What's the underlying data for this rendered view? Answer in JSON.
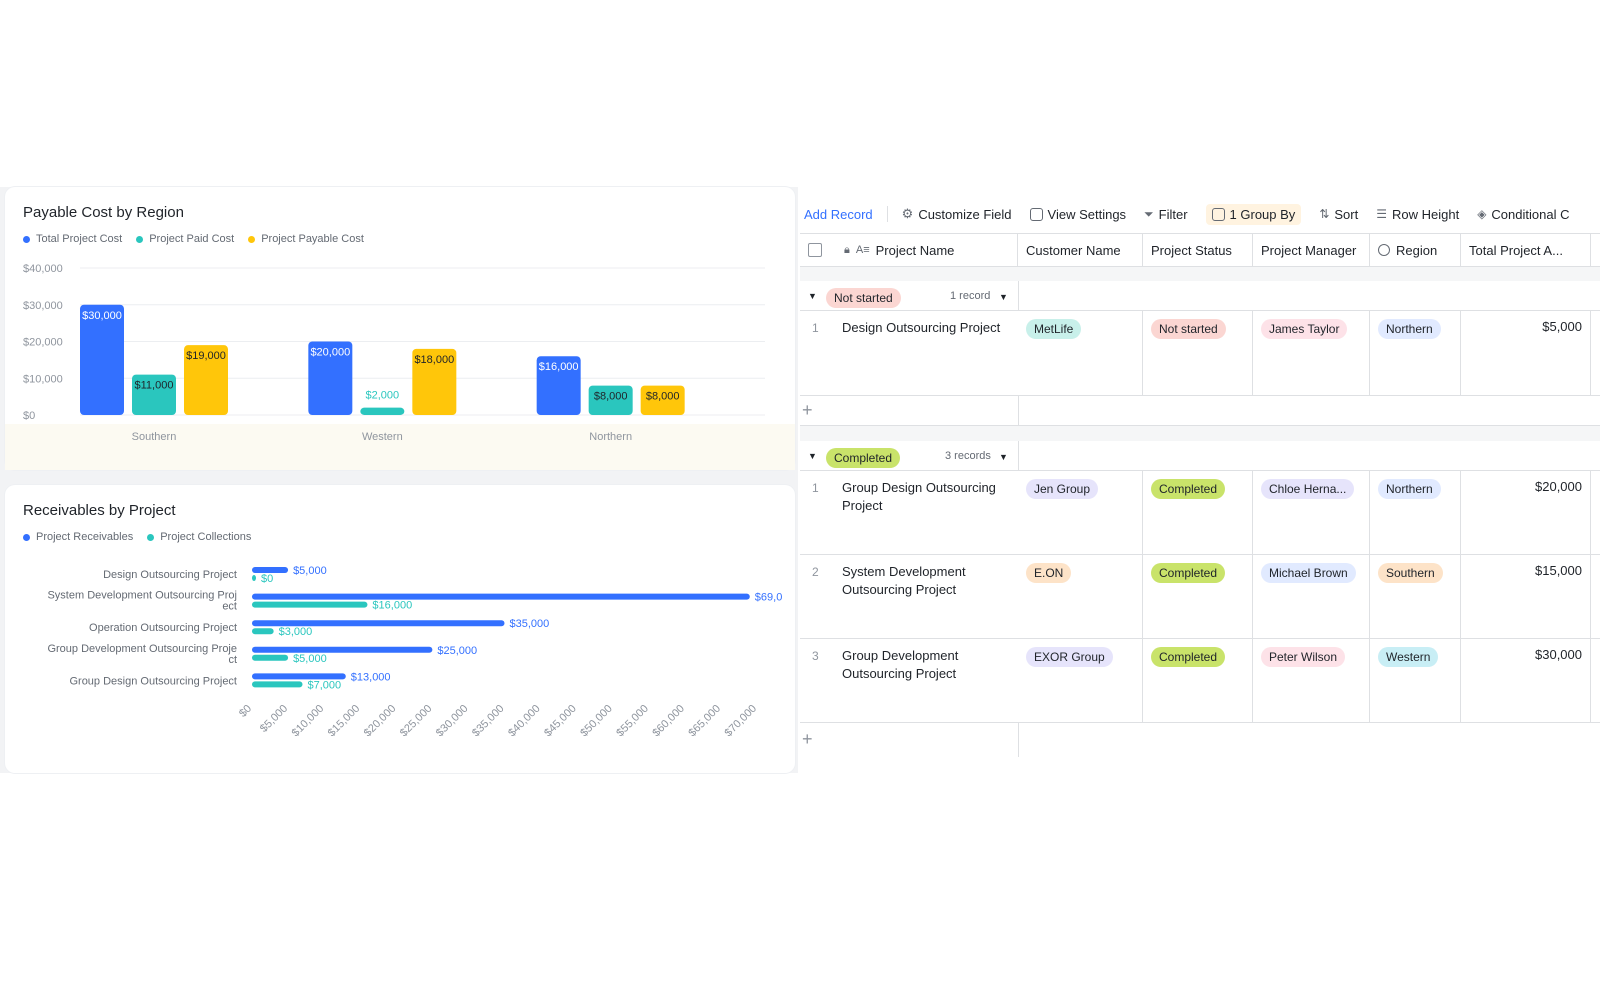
{
  "payable_card": {
    "title": "Payable Cost by Region",
    "legend": [
      {
        "label": "Total Project Cost",
        "color": "#3370ff"
      },
      {
        "label": "Project Paid Cost",
        "color": "#2ac6be"
      },
      {
        "label": "Project Payable Cost",
        "color": "#ffc60a"
      }
    ]
  },
  "receivables_card": {
    "title": "Receivables by Project",
    "legend": [
      {
        "label": "Project Receivables",
        "color": "#3370ff"
      },
      {
        "label": "Project Collections",
        "color": "#2ac6be"
      }
    ]
  },
  "chart_data": [
    {
      "type": "bar",
      "title": "Payable Cost by Region",
      "categories": [
        "Southern",
        "Western",
        "Northern"
      ],
      "y_ticks": [
        "$0",
        "$10,000",
        "$20,000",
        "$30,000",
        "$40,000"
      ],
      "ylim": [
        0,
        40000
      ],
      "legend_position": "top-left",
      "series": [
        {
          "name": "Total Project Cost",
          "color": "#3370ff",
          "values": [
            30000,
            20000,
            16000
          ],
          "labels": [
            "$30,000",
            "$20,000",
            "$16,000"
          ]
        },
        {
          "name": "Project Paid Cost",
          "color": "#2ac6be",
          "values": [
            11000,
            2000,
            8000
          ],
          "labels": [
            "$11,000",
            "$2,000",
            "$8,000"
          ]
        },
        {
          "name": "Project Payable Cost",
          "color": "#ffc60a",
          "values": [
            19000,
            18000,
            8000
          ],
          "labels": [
            "$19,000",
            "$18,000",
            "$8,000"
          ]
        }
      ]
    },
    {
      "type": "bar",
      "orientation": "horizontal",
      "title": "Receivables by Project",
      "categories": [
        "Design Outsourcing Project",
        "System Development Outsourcing Project",
        "Operation Outsourcing Project",
        "Group Development Outsourcing Project",
        "Group Design Outsourcing Project"
      ],
      "category_lines": [
        [
          "Design Outsourcing Project"
        ],
        [
          "System Development Outsourcing Proj",
          "ect"
        ],
        [
          "Operation Outsourcing Project"
        ],
        [
          "Group Development Outsourcing Proje",
          "ct"
        ],
        [
          "Group Design Outsourcing Project"
        ]
      ],
      "x_ticks": [
        "$0",
        "$5,000",
        "$10,000",
        "$15,000",
        "$20,000",
        "$25,000",
        "$30,000",
        "$35,000",
        "$40,000",
        "$45,000",
        "$50,000",
        "$55,000",
        "$60,000",
        "$65,000",
        "$70,000"
      ],
      "xlim": [
        0,
        70000
      ],
      "legend_position": "top-left",
      "series": [
        {
          "name": "Project Receivables",
          "color": "#3370ff",
          "values": [
            5000,
            69000,
            35000,
            25000,
            13000
          ],
          "labels": [
            "$5,000",
            "$69,0",
            "$35,000",
            "$25,000",
            "$13,000"
          ]
        },
        {
          "name": "Project Collections",
          "color": "#2ac6be",
          "values": [
            0,
            16000,
            3000,
            5000,
            7000
          ],
          "labels": [
            "$0",
            "$16,000",
            "$3,000",
            "$5,000",
            "$7,000"
          ]
        }
      ]
    }
  ],
  "toolbar": {
    "add_record": "Add Record",
    "customize_field": "Customize Field",
    "view_settings": "View Settings",
    "filter": "Filter",
    "group_by": "1 Group By",
    "sort": "Sort",
    "row_height": "Row Height",
    "conditional": "Conditional C"
  },
  "columns": {
    "project_name": "Project Name",
    "customer_name": "Customer Name",
    "project_status": "Project Status",
    "project_manager": "Project Manager",
    "region": "Region",
    "total_project": "Total Project A..."
  },
  "groups": [
    {
      "status": "Not started",
      "count": "1 record"
    },
    {
      "status": "Completed",
      "count": "3 records"
    }
  ],
  "rows": [
    {
      "n": "1",
      "project": "Design Outsourcing Project",
      "customer": "MetLife",
      "status": "Not started",
      "manager": "James Taylor",
      "region": "Northern",
      "total": "$5,000"
    },
    {
      "n": "1",
      "project": "Group Design Outsourcing Project",
      "customer": "Jen Group",
      "status": "Completed",
      "manager": "Chloe Herna...",
      "region": "Northern",
      "total": "$20,000"
    },
    {
      "n": "2",
      "project": "System Development Outsourcing Project",
      "customer": "E.ON",
      "status": "Completed",
      "manager": "Michael Brown",
      "region": "Southern",
      "total": "$15,000"
    },
    {
      "n": "3",
      "project": "Group Development Outsourcing Project",
      "customer": "EXOR Group",
      "status": "Completed",
      "manager": "Peter Wilson",
      "region": "Western",
      "total": "$30,000"
    }
  ],
  "colors": {
    "not_started_bg": "#fbd6d2",
    "completed_bg": "#c9e36a",
    "customer_metlife": "#c8f0ea",
    "customer_jen": "#e6e4fb",
    "customer_eon": "#fde3c8",
    "customer_exor": "#e6e4fb",
    "region_northern": "#e1eaff",
    "region_southern": "#fde3c8",
    "region_western": "#c8eef5",
    "manager_james": "#fde2e8",
    "manager_chloe": "#e6e4fb",
    "manager_michael": "#e1eaff",
    "manager_peter": "#fde2e8"
  }
}
